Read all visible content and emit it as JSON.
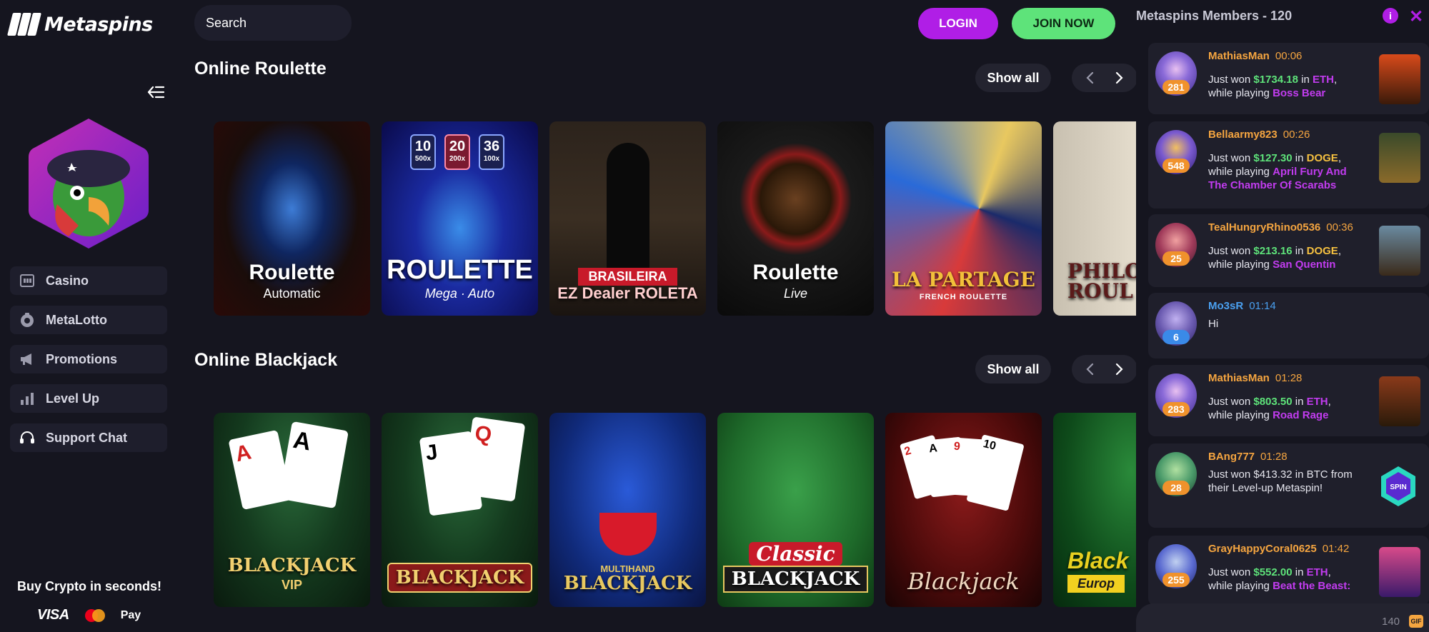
{
  "brand": {
    "name": "Metaspins"
  },
  "header": {
    "search_placeholder": "Search",
    "login_label": "LOGIN",
    "join_label": "JOIN NOW"
  },
  "sidebar": {
    "items": [
      {
        "label": "Casino",
        "icon": "casino-icon"
      },
      {
        "label": "MetaLotto",
        "icon": "lotto-icon"
      },
      {
        "label": "Promotions",
        "icon": "megaphone-icon"
      },
      {
        "label": "Level Up",
        "icon": "bar-chart-icon"
      },
      {
        "label": "Support Chat",
        "icon": "headset-icon"
      }
    ],
    "buy_crypto": "Buy Crypto in seconds!",
    "payments": {
      "visa": "VISA",
      "apple_pay": "Pay"
    }
  },
  "sections": [
    {
      "title": "Online Roulette",
      "show_all": "Show all",
      "games": [
        {
          "main": "Roulette",
          "sub": "Automatic"
        },
        {
          "main": "ROULETTE",
          "sub": "Mega · Auto",
          "tags": [
            "10",
            "20",
            "36"
          ],
          "tag_subs": [
            "500x",
            "200x",
            "100x"
          ]
        },
        {
          "main": "EZ Dealer ROLETA",
          "sub": "BRASILEIRA"
        },
        {
          "main": "Roulette",
          "sub": "Live"
        },
        {
          "main": "LA PARTAGE",
          "sub": "FRENCH ROULETTE"
        },
        {
          "main": "PHILOSO ROUL",
          "sub": ""
        }
      ]
    },
    {
      "title": "Online Blackjack",
      "show_all": "Show all",
      "games": [
        {
          "main": "BLACKJACK",
          "sub": "VIP"
        },
        {
          "main": "BLACKJACK",
          "sub": ""
        },
        {
          "main": "BLACKJACK",
          "sub": "MULTIHAND"
        },
        {
          "main": "BLACKJACK",
          "sub": "Classic"
        },
        {
          "main": "Blackjack",
          "sub": ""
        },
        {
          "main": "Black",
          "sub": "Europ"
        }
      ]
    }
  ],
  "chat": {
    "title": "Metaspins Members - 120",
    "char_count": "140",
    "gif_label": "GIF",
    "messages": [
      {
        "name": "MathiasMan",
        "time": "00:06",
        "level": "281",
        "amount": "$1734.18",
        "coin": "ETH",
        "game": "Boss Bear",
        "color": "#5a7be8"
      },
      {
        "name": "Bellaarmy823",
        "time": "00:26",
        "level": "548",
        "amount": "$127.30",
        "coin": "DOGE",
        "game": "April Fury And The Chamber Of Scarabs",
        "color": "#7a5ad0"
      },
      {
        "name": "TealHungryRhino0536",
        "time": "00:36",
        "level": "25",
        "amount": "$213.16",
        "coin": "DOGE",
        "game": "San Quentin",
        "color": "#d06a8a"
      },
      {
        "name": "Mo3sR",
        "time": "01:14",
        "level": "6",
        "text": "Hi",
        "color": "#8a7ad8"
      },
      {
        "name": "MathiasMan",
        "time": "01:28",
        "level": "283",
        "amount": "$803.50",
        "coin": "ETH",
        "game": "Road Rage",
        "color": "#5a7be8"
      },
      {
        "name": "BAng777",
        "time": "01:28",
        "level": "28",
        "text": "Just won $413.32 in BTC from their Level-up Metaspin!",
        "color": "#4a9a6a"
      },
      {
        "name": "GrayHappyCoral0625",
        "time": "01:42",
        "level": "255",
        "amount": "$552.00",
        "coin": "ETH",
        "game": "Beat the Beast:",
        "color": "#6a7ad8"
      }
    ],
    "labels": {
      "just_won": "Just won",
      "in": "in",
      "while_playing": "while playing"
    }
  }
}
